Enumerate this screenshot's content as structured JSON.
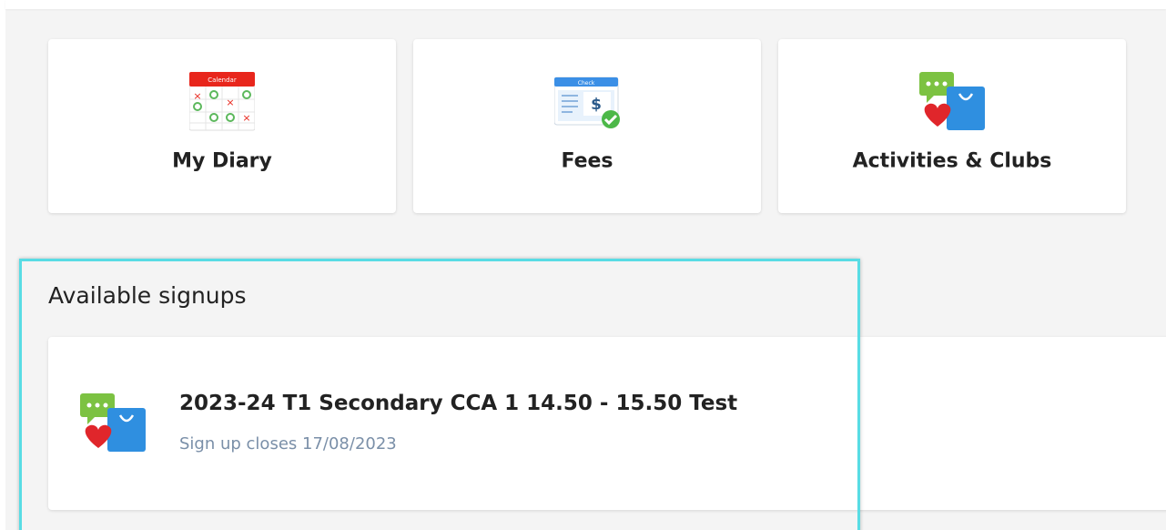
{
  "tiles": [
    {
      "label": "My Diary",
      "icon": "calendar-icon",
      "icon_header_text": "Calendar"
    },
    {
      "label": "Fees",
      "icon": "check-payment-icon",
      "icon_header_text": "Check"
    },
    {
      "label": "Activities & Clubs",
      "icon": "activities-clubs-icon"
    }
  ],
  "signups": {
    "title": "Available signups",
    "items": [
      {
        "title": "2023-24 T1 Secondary CCA 1 14.50 - 15.50 Test",
        "subtitle": "Sign up closes 17/08/2023",
        "icon": "activities-clubs-icon"
      }
    ]
  },
  "colors": {
    "background": "#f4f4f4",
    "card": "#ffffff",
    "highlight_border": "#58dce4",
    "subtitle": "#7a8fa8"
  }
}
